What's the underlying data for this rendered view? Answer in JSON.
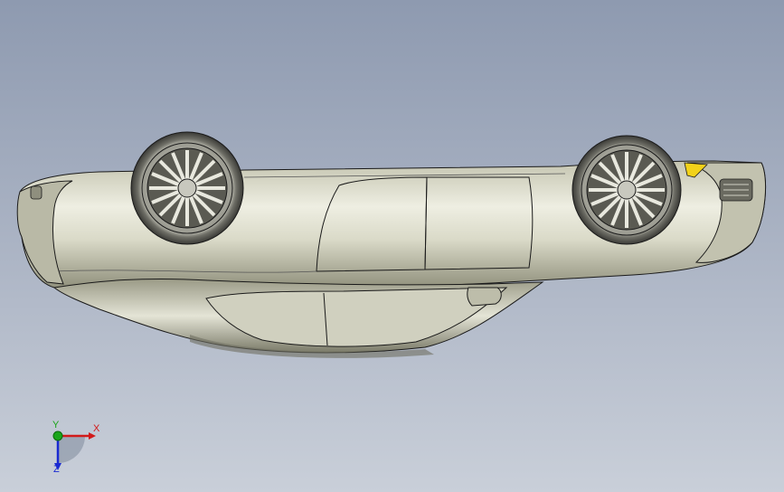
{
  "viewport": {
    "background_top": "#8e9ab0",
    "background_bottom": "#c9cfd9"
  },
  "model": {
    "body_color": "#d9d9c8",
    "body_shadow": "#8c8c78",
    "outline_color": "#1a1a1a",
    "highlight_color": "#f2d21a"
  },
  "triad": {
    "x_label": "X",
    "y_label": "Y",
    "z_label": "Z",
    "x_color": "#d21a1a",
    "y_color": "#1aa51a",
    "z_color": "#1a2ad2"
  }
}
